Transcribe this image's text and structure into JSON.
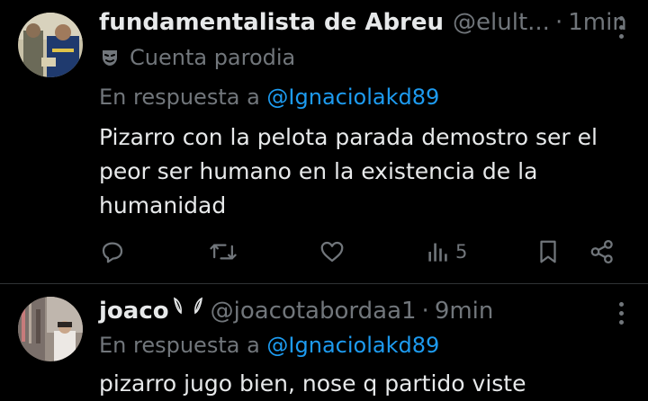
{
  "tweets": [
    {
      "author_name": "fundamentalista de Abreu",
      "handle": "@elult...",
      "separator": "·",
      "time": "1min",
      "parody_label": "Cuenta parodia",
      "reply_prefix": "En respuesta a",
      "reply_mention": "@Ignaciolakd89",
      "text": "Pizarro con la pelota parada demostro ser el peor ser humano en la existencia de la humanidad",
      "views": "5"
    },
    {
      "author_name": "joaco",
      "handle": "@joacotabordaa1",
      "separator": "·",
      "time": "9min",
      "reply_prefix": "En respuesta a",
      "reply_mention": "@Ignaciolakd89",
      "text": "pizarro jugo bien, nose q partido viste"
    }
  ],
  "icons": {
    "more": "more-vertical-icon",
    "parody": "theater-mask-icon",
    "reply": "reply-icon",
    "retweet": "retweet-icon",
    "like": "heart-icon",
    "views": "views-chart-icon",
    "bookmark": "bookmark-icon",
    "share": "share-icon",
    "name_emoji": "leaf-icon"
  },
  "colors": {
    "background": "#000000",
    "text": "#e7e9ea",
    "muted": "#71767b",
    "link": "#1d9bf0",
    "divider": "#2f3336"
  }
}
